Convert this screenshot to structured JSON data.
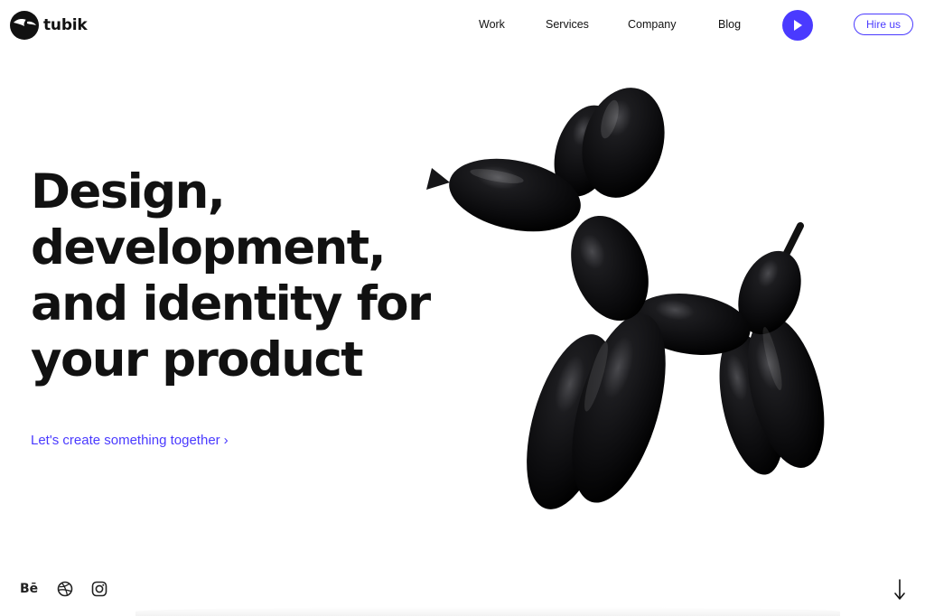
{
  "brand": {
    "name": "tubik"
  },
  "nav": {
    "items": [
      {
        "label": "Work"
      },
      {
        "label": "Services"
      },
      {
        "label": "Company"
      },
      {
        "label": "Blog"
      }
    ],
    "hire_label": "Hire us"
  },
  "hero": {
    "title_lines": [
      "Design,",
      "development,",
      "and identity for",
      "your product"
    ],
    "cta_label": "Let's create something together",
    "cta_chevron": "›"
  },
  "footer": {
    "behance_label": "Bē",
    "scroll_glyph": "↓"
  },
  "colors": {
    "accent": "#4a3aff",
    "text": "#111111",
    "background": "#ffffff",
    "balloon": "#0b0b0d"
  },
  "icons": {
    "logo": "toucan-bird-icon",
    "play": "play-icon",
    "behance": "behance-icon",
    "dribbble": "dribbble-icon",
    "instagram": "instagram-icon",
    "scroll": "arrow-down-icon"
  }
}
